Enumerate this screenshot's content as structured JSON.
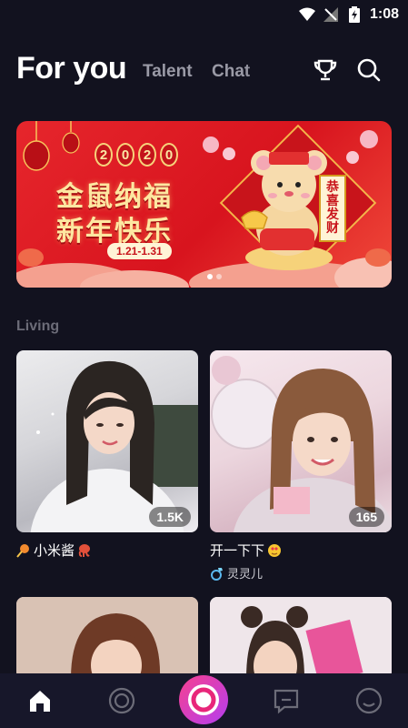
{
  "status_bar": {
    "time": "1:08"
  },
  "header": {
    "tabs": [
      {
        "label": "For you",
        "active": true
      },
      {
        "label": "Talent",
        "active": false
      },
      {
        "label": "Chat",
        "active": false
      }
    ],
    "icons": [
      "trophy-icon",
      "search-icon"
    ]
  },
  "banner": {
    "year": [
      "2",
      "0",
      "2",
      "0"
    ],
    "line1": "金鼠纳福",
    "line2": "新年快乐",
    "date": "1.21-1.31",
    "scroll": "恭喜发财",
    "slide_count": 2,
    "active_slide": 1
  },
  "section": {
    "label": "Living"
  },
  "cards": [
    {
      "viewers": "1.5K",
      "title": "小米酱",
      "icons": [
        "lollipop-icon",
        "octopus-icon"
      ]
    },
    {
      "viewers": "165",
      "title": "开一下下",
      "title_icon": "heart-face-icon",
      "host": "灵灵儿",
      "host_icon": "ring-icon"
    },
    {
      "viewers": ""
    },
    {
      "viewers": ""
    }
  ],
  "bottom_nav": {
    "items": [
      "home-icon",
      "live-icon",
      "go-live-icon",
      "message-icon",
      "profile-icon"
    ],
    "active": "home-icon"
  },
  "colors": {
    "background": "#12121f",
    "accent": "#e8267a",
    "banner_red": "#e6262c"
  }
}
